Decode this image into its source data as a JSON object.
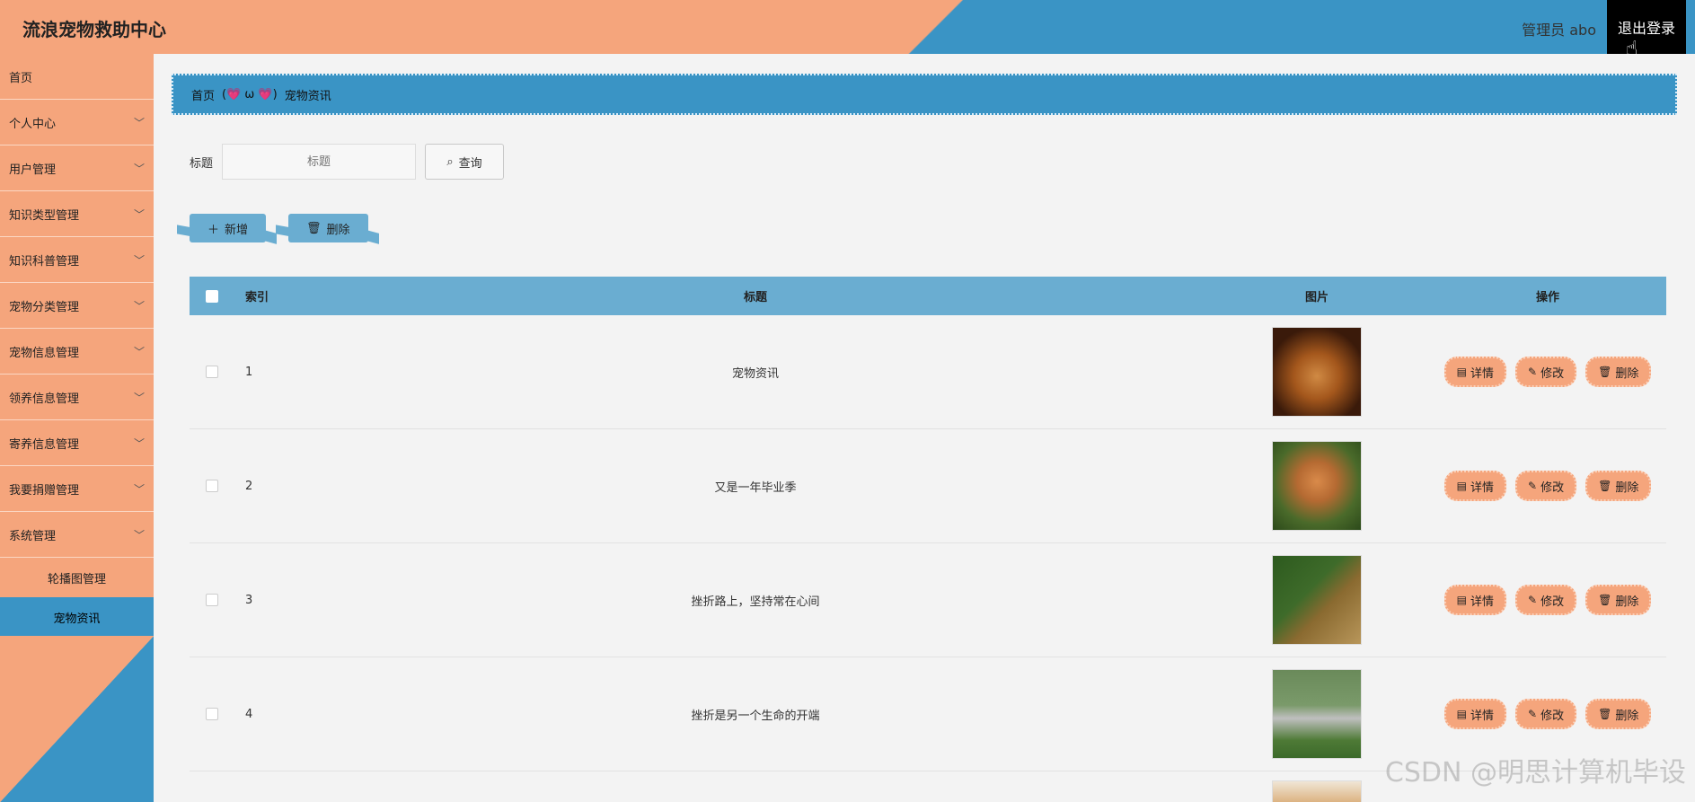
{
  "header": {
    "title": "流浪宠物救助中心",
    "user": "管理员 abo",
    "logout": "退出登录"
  },
  "sidebar": {
    "items": [
      {
        "label": "首页",
        "chevron": false
      },
      {
        "label": "个人中心",
        "chevron": true
      },
      {
        "label": "用户管理",
        "chevron": true
      },
      {
        "label": "知识类型管理",
        "chevron": true
      },
      {
        "label": "知识科普管理",
        "chevron": true
      },
      {
        "label": "宠物分类管理",
        "chevron": true
      },
      {
        "label": "宠物信息管理",
        "chevron": true
      },
      {
        "label": "领养信息管理",
        "chevron": true
      },
      {
        "label": "寄养信息管理",
        "chevron": true
      },
      {
        "label": "我要捐赠管理",
        "chevron": true
      },
      {
        "label": "系统管理",
        "chevron": true
      }
    ],
    "sub_items": [
      {
        "label": "轮播图管理",
        "active": false
      },
      {
        "label": "宠物资讯",
        "active": true
      }
    ]
  },
  "breadcrumb": {
    "home": "首页",
    "separator": "(💗 ω 💗)",
    "current": "宠物资讯"
  },
  "search": {
    "label": "标题",
    "placeholder": "标题",
    "query_button": "查询"
  },
  "actions": {
    "add": "新增",
    "delete": "删除"
  },
  "table": {
    "columns": {
      "index": "索引",
      "title": "标题",
      "picture": "图片",
      "operation": "操作"
    },
    "rows": [
      {
        "index": "1",
        "title": "宠物资讯"
      },
      {
        "index": "2",
        "title": "又是一年毕业季"
      },
      {
        "index": "3",
        "title": "挫折路上，坚持常在心间"
      },
      {
        "index": "4",
        "title": "挫折是另一个生命的开端"
      }
    ],
    "ops": {
      "detail": "详情",
      "edit": "修改",
      "delete": "删除"
    }
  },
  "watermark": "CSDN @明思计算机毕设",
  "colors": {
    "orange": "#f5a57c",
    "blue": "#3a94c5",
    "table_header": "#6aadd1"
  }
}
